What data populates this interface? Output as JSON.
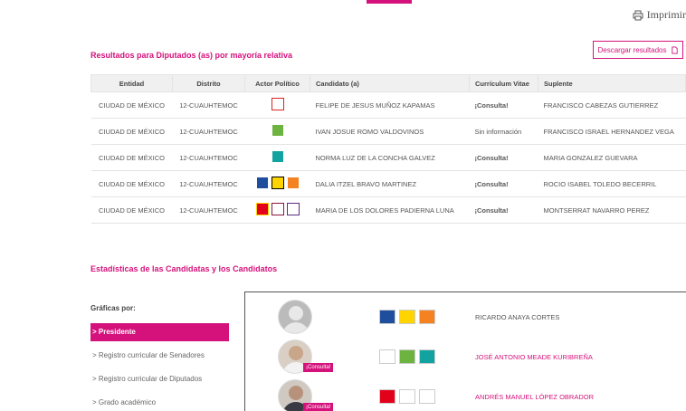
{
  "print_label": "Imprimir",
  "results_section": {
    "title": "Resultados para Diputados (as) por mayoría relativa",
    "download_label": "Descargar resultados",
    "headers": [
      "Entidad",
      "Distrito",
      "Actor Político",
      "Candidato (a)",
      "Currículum Vitae",
      "Suplente"
    ],
    "rows": [
      {
        "entidad": "CIUDAD DE MÉXICO",
        "distrito": "12-CUAUHTEMOC",
        "logos": [
          {
            "name": "pri-verde-logo",
            "bg": "#ffffff",
            "fg": "#d7261e"
          }
        ],
        "candidato": "FELIPE DE JESUS MUÑOZ KAPAMAS",
        "cv": "¡Consulta!",
        "cv_available": true,
        "suplente": "FRANCISCO CABEZAS GUTIERREZ"
      },
      {
        "entidad": "CIUDAD DE MÉXICO",
        "distrito": "12-CUAUHTEMOC",
        "logos": [
          {
            "name": "verde-logo",
            "bg": "#6cb33f",
            "fg": "#ffffff"
          }
        ],
        "candidato": "IVAN JOSUE ROMO VALDOVINOS",
        "cv": "Sin información",
        "cv_available": false,
        "suplente": "FRANCISCO ISRAEL HERNANDEZ VEGA"
      },
      {
        "entidad": "CIUDAD DE MÉXICO",
        "distrito": "12-CUAUHTEMOC",
        "logos": [
          {
            "name": "nueva-alianza-logo",
            "bg": "#12a3a0",
            "fg": "#ffffff"
          }
        ],
        "candidato": "NORMA LUZ DE LA CONCHA GALVEZ",
        "cv": "¡Consulta!",
        "cv_available": true,
        "suplente": "MARIA GONZALEZ GUEVARA"
      },
      {
        "entidad": "CIUDAD DE MÉXICO",
        "distrito": "12-CUAUHTEMOC",
        "logos": [
          {
            "name": "pan-logo",
            "bg": "#1f4e9c",
            "fg": "#ffffff"
          },
          {
            "name": "prd-logo",
            "bg": "#ffd400",
            "fg": "#000000"
          },
          {
            "name": "mc-logo",
            "bg": "#f58220",
            "fg": "#ffffff"
          }
        ],
        "candidato": "DALIA ITZEL BRAVO MARTINEZ",
        "cv": "¡Consulta!",
        "cv_available": true,
        "suplente": "ROCIO ISABEL TOLEDO BECERRIL"
      },
      {
        "entidad": "CIUDAD DE MÉXICO",
        "distrito": "12-CUAUHTEMOC",
        "logos": [
          {
            "name": "pt-logo",
            "bg": "#e2001a",
            "fg": "#ffd400"
          },
          {
            "name": "morena-logo",
            "bg": "#ffffff",
            "fg": "#8a1538"
          },
          {
            "name": "pes-logo",
            "bg": "#ffffff",
            "fg": "#5b2c83"
          }
        ],
        "candidato": "MARIA DE LOS DOLORES PADIERNA LUNA",
        "cv": "¡Consulta!",
        "cv_available": true,
        "suplente": "MONTSERRAT NAVARRO PEREZ"
      }
    ]
  },
  "stats_section": {
    "title": "Estadísticas de las Candidatas y los Candidatos",
    "graficas_label": "Gráficas por:",
    "menu": [
      {
        "label": "> Presidente",
        "active": true
      },
      {
        "label": "> Registro curricular de Senadores",
        "active": false
      },
      {
        "label": "> Registro curricular de Diputados",
        "active": false
      },
      {
        "label": "> Grado académico",
        "active": false
      }
    ],
    "candidates": [
      {
        "name": "RICARDO ANAYA CORTES",
        "highlight": false,
        "has_photo": false,
        "consulta": "",
        "logos": [
          {
            "name": "pan-logo",
            "bg": "#1f4e9c"
          },
          {
            "name": "prd-logo",
            "bg": "#ffd400"
          },
          {
            "name": "mc-logo",
            "bg": "#f58220"
          }
        ]
      },
      {
        "name": "JOSÉ ANTONIO MEADE KURIBREÑA",
        "highlight": true,
        "has_photo": true,
        "consulta": "¡Consulta!",
        "logos": [
          {
            "name": "pri-logo",
            "bg": "#ffffff"
          },
          {
            "name": "verde-logo",
            "bg": "#6cb33f"
          },
          {
            "name": "nueva-alianza-logo",
            "bg": "#12a3a0"
          }
        ]
      },
      {
        "name": "ANDRÉS MANUEL LÓPEZ OBRADOR",
        "highlight": true,
        "has_photo": true,
        "consulta": "¡Consulta!",
        "logos": [
          {
            "name": "pt-logo",
            "bg": "#e2001a"
          },
          {
            "name": "morena-logo",
            "bg": "#ffffff"
          },
          {
            "name": "pes-logo",
            "bg": "#ffffff"
          }
        ]
      }
    ]
  },
  "colors": {
    "accent": "#d5127c"
  }
}
